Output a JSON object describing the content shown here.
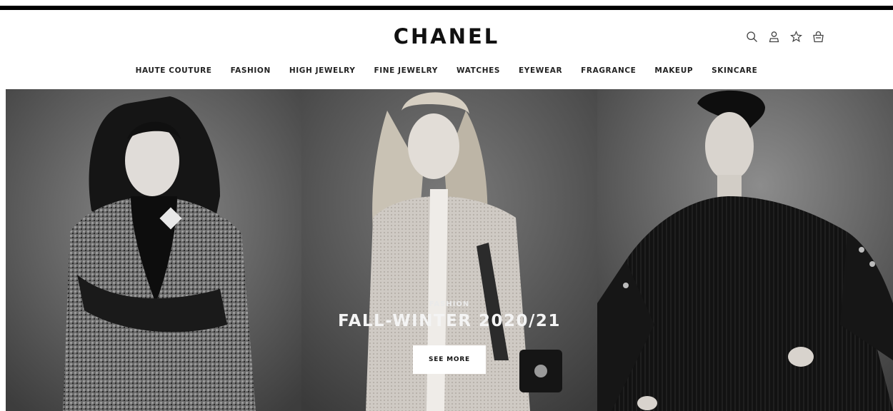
{
  "brand": {
    "name": "CHANEL"
  },
  "utility_icons": [
    "search-icon",
    "account-icon",
    "wishlist-icon",
    "bag-icon"
  ],
  "nav": {
    "items": [
      "HAUTE COUTURE",
      "FASHION",
      "HIGH JEWELRY",
      "FINE JEWELRY",
      "WATCHES",
      "EYEWEAR",
      "FRAGRANCE",
      "MAKEUP",
      "SKINCARE"
    ]
  },
  "hero": {
    "eyebrow": "FASHION",
    "title": "FALL-WINTER 2020/21",
    "cta": "SEE MORE"
  },
  "colors": {
    "top_rule": "#000000",
    "background": "#ffffff",
    "text": "#111111"
  }
}
